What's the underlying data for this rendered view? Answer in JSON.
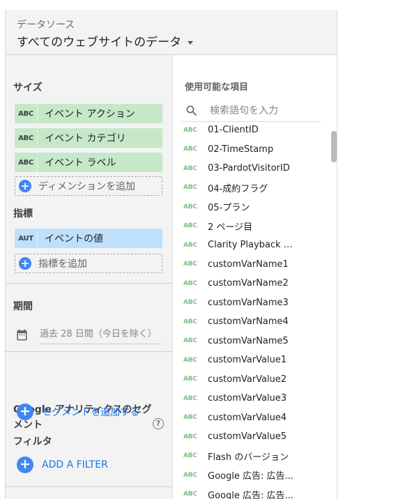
{
  "data_source": {
    "label": "データソース",
    "name": "すべてのウェブサイトのデータ"
  },
  "dimensions": {
    "title": "サイズ",
    "items": [
      {
        "tag": "ABC",
        "label": "イベント アクション"
      },
      {
        "tag": "ABC",
        "label": "イベント カテゴリ"
      },
      {
        "tag": "ABC",
        "label": "イベント ラベル"
      }
    ],
    "add_label": "ディメンションを追加"
  },
  "metrics": {
    "title": "指標",
    "items": [
      {
        "tag": "AUT",
        "label": "イベントの値"
      }
    ],
    "add_label": "指標を追加"
  },
  "period": {
    "title": "期間",
    "value": "過去 28 日間（今日を除く）"
  },
  "segments": {
    "title": "Google アナリティクスのセグメント",
    "add_label": "セグメントを追加する"
  },
  "filter": {
    "title": "フィルタ",
    "add_label": "ADD A FILTER"
  },
  "available_fields": {
    "title": "使用可能な項目",
    "search_placeholder": "検索語句を入力",
    "tag": "ABC",
    "items": [
      "01-ClientID",
      "02-TimeStamp",
      "03-PardotVisitorID",
      "04-成約フラグ",
      "05-プラン",
      "2 ページ目",
      "Clarity Playback U...",
      "customVarName1",
      "customVarName2",
      "customVarName3",
      "customVarName4",
      "customVarName5",
      "customVarValue1",
      "customVarValue2",
      "customVarValue3",
      "customVarValue4",
      "customVarValue5",
      "Flash のバージョン",
      "Google 広告: 広告...",
      "Google 広告: 広告..."
    ]
  },
  "colors": {
    "dimension_chip": "#c6e8c9",
    "metric_chip": "#bfe0fb",
    "accent": "#4285f4",
    "link": "#1a73e8"
  },
  "icons": {
    "dropdown": "caret-down-icon",
    "add": "plus-circle-icon",
    "calendar": "calendar-icon",
    "help": "help-circle-icon",
    "search": "search-icon"
  }
}
